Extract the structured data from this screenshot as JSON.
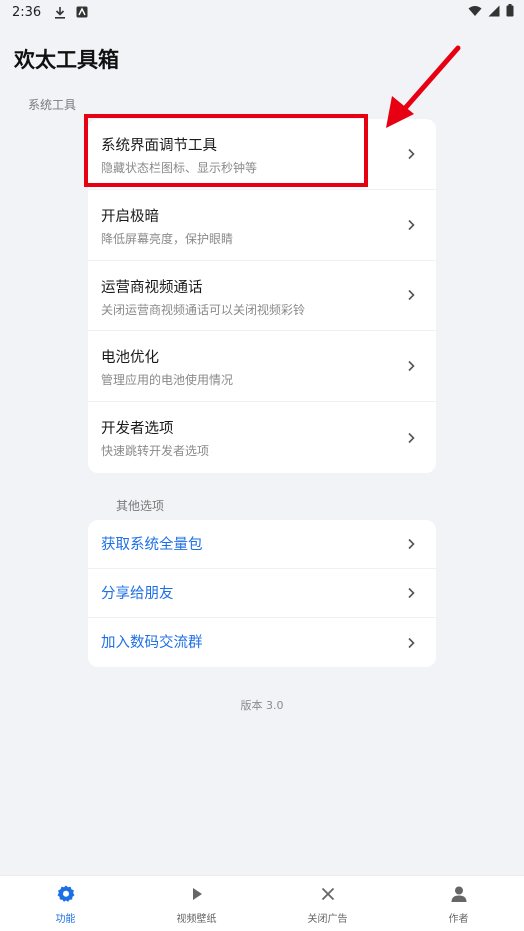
{
  "status_bar": {
    "time": "2:36",
    "icons": [
      "download-icon",
      "notification-app-icon",
      "wifi-icon",
      "signal-icon",
      "battery-icon"
    ]
  },
  "header": {
    "title": "欢太工具箱"
  },
  "sections": {
    "system": {
      "label": "系统工具",
      "items": [
        {
          "title": "系统界面调节工具",
          "subtitle": "隐藏状态栏图标、显示秒钟等"
        },
        {
          "title": "开启极暗",
          "subtitle": "降低屏幕亮度，保护眼睛"
        },
        {
          "title": "运营商视频通话",
          "subtitle": "关闭运营商视频通话可以关闭视频彩铃"
        },
        {
          "title": "电池优化",
          "subtitle": "管理应用的电池使用情况"
        },
        {
          "title": "开发者选项",
          "subtitle": "快速跳转开发者选项"
        }
      ]
    },
    "other": {
      "label": "其他选项",
      "items": [
        {
          "title": "获取系统全量包"
        },
        {
          "title": "分享给朋友"
        },
        {
          "title": "加入数码交流群"
        }
      ]
    }
  },
  "version": "版本 3.0",
  "bottom_nav": {
    "items": [
      {
        "label": "功能",
        "icon": "gear-icon",
        "active": true
      },
      {
        "label": "视频壁纸",
        "icon": "play-icon",
        "active": false
      },
      {
        "label": "关闭广告",
        "icon": "close-icon",
        "active": false
      },
      {
        "label": "作者",
        "icon": "person-icon",
        "active": false
      }
    ]
  },
  "colors": {
    "accent": "#1e6fe6",
    "background": "#f2f3f7",
    "highlight": "#e60012"
  }
}
